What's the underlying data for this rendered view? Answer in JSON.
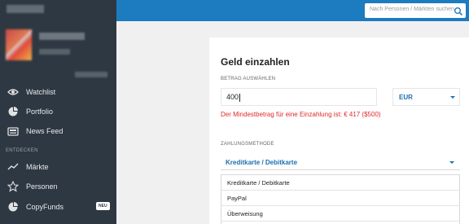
{
  "sidebar": {
    "items": [
      {
        "label": "Watchlist",
        "icon": "eye-icon"
      },
      {
        "label": "Portfolio",
        "icon": "pie-chart-icon"
      },
      {
        "label": "News Feed",
        "icon": "news-feed-icon"
      }
    ],
    "section_label": "ENTDECKEN",
    "discover_items": [
      {
        "label": "Märkte",
        "icon": "trend-line-icon"
      },
      {
        "label": "Personen",
        "icon": "star-icon"
      },
      {
        "label": "CopyFunds",
        "icon": "pie-chart-icon",
        "badge": "NEU"
      }
    ]
  },
  "topbar": {
    "search_placeholder": "Nach Personen / Märkten suchen",
    "color": "#1d7bc0"
  },
  "deposit": {
    "title": "Geld einzahlen",
    "amount_label": "BETRAG AUSWÄHLEN",
    "amount_value": "400",
    "currency": "EUR",
    "error": "Der Mindestbetrag für eine Einzahlung ist: € 417 ($500)",
    "method_label": "ZAHLUNGSMETHODE",
    "method_selected": "Kreditkarte / Debitkarte",
    "method_options": [
      "Kreditkarte / Debitkarte",
      "PayPal",
      "Überweisung"
    ]
  },
  "colors": {
    "sidebar_bg": "#2e3842",
    "accent": "#1b6fb1",
    "error": "#e02a2a"
  }
}
